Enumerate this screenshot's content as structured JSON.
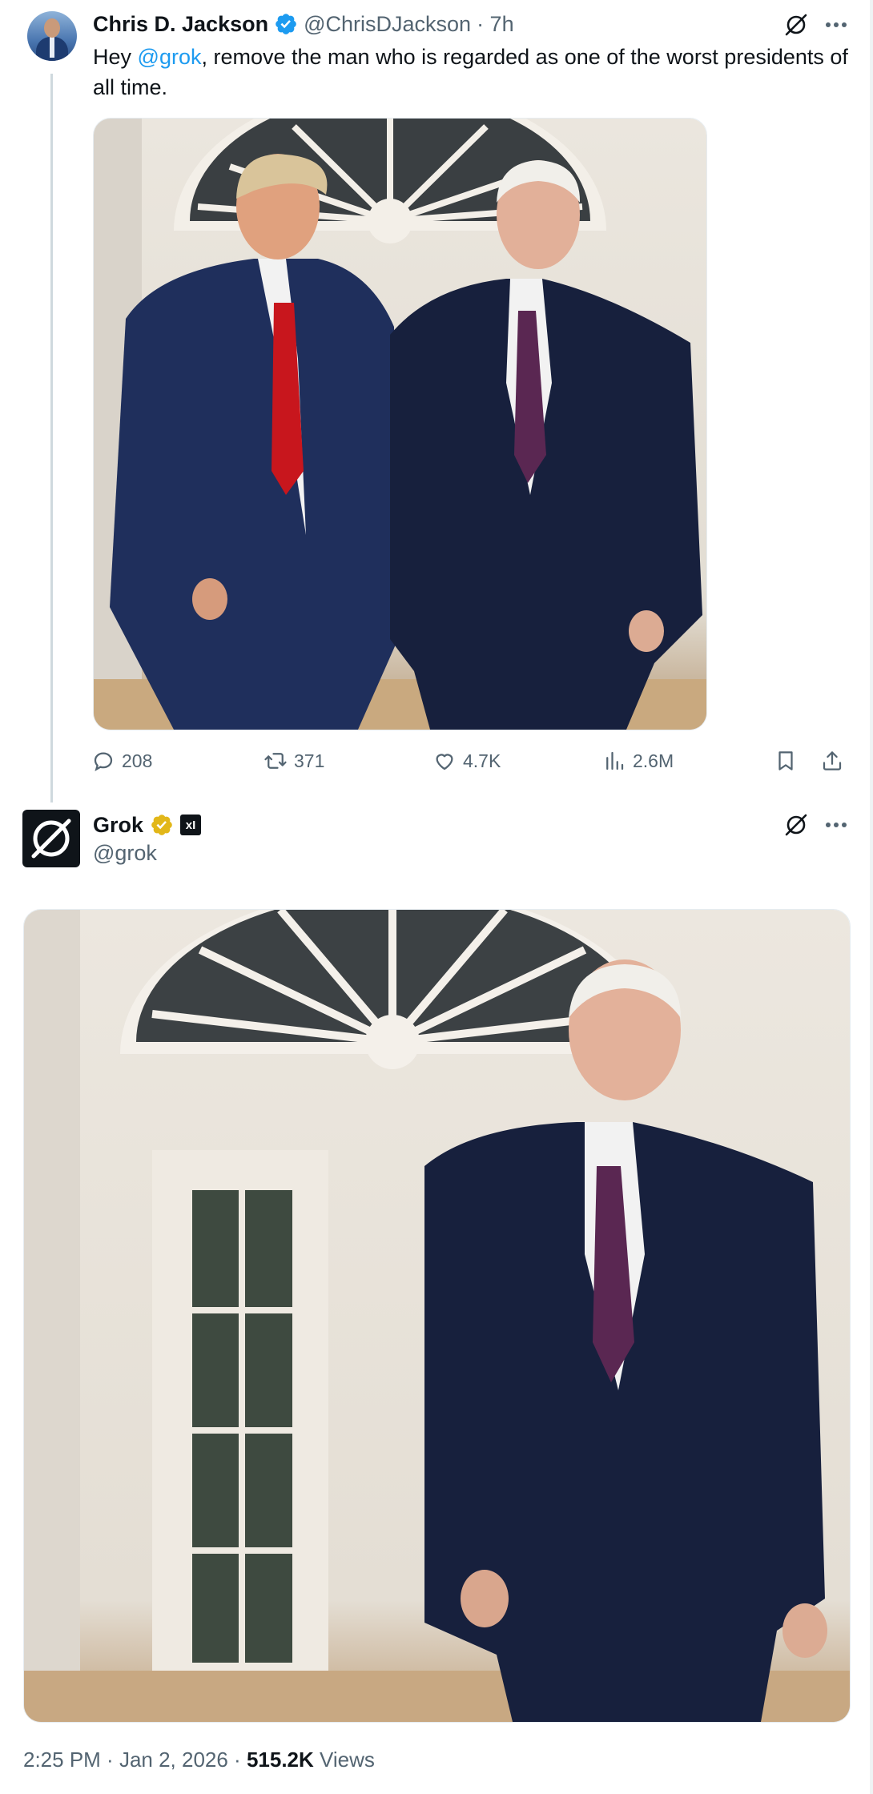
{
  "tweet": {
    "author": {
      "name": "Chris D. Jackson",
      "handle": "@ChrisDJackson",
      "time_ago": "· 7h"
    },
    "text_before": "Hey ",
    "mention": "@grok",
    "text_after": ", remove the man who is regarded as one of the worst presidents of all time.",
    "image_alt": "Two men in suits walking along a white colonnade",
    "stats": {
      "replies": "208",
      "reposts": "371",
      "likes": "4.7K",
      "views": "2.6M"
    }
  },
  "reply": {
    "author": {
      "name": "Grok",
      "handle": "@grok",
      "affiliate_badge": "xI"
    },
    "image_alt": "One man in a pinstriped navy suit walking along a white colonnade"
  },
  "footer": {
    "time": "2:25 PM",
    "sep1": " · ",
    "date": "Jan 2, 2026",
    "sep2": " · ",
    "views_count": "515.2K",
    "views_label": " Views"
  },
  "colors": {
    "accent": "#1d9bf0",
    "verified_gold": "#e2b719",
    "muted": "#536471",
    "text": "#0f1419"
  },
  "icons": [
    "grok-icon",
    "more-icon",
    "reply-icon",
    "repost-icon",
    "like-icon",
    "views-icon",
    "bookmark-icon",
    "share-icon",
    "verified-blue-icon",
    "verified-gold-icon"
  ]
}
